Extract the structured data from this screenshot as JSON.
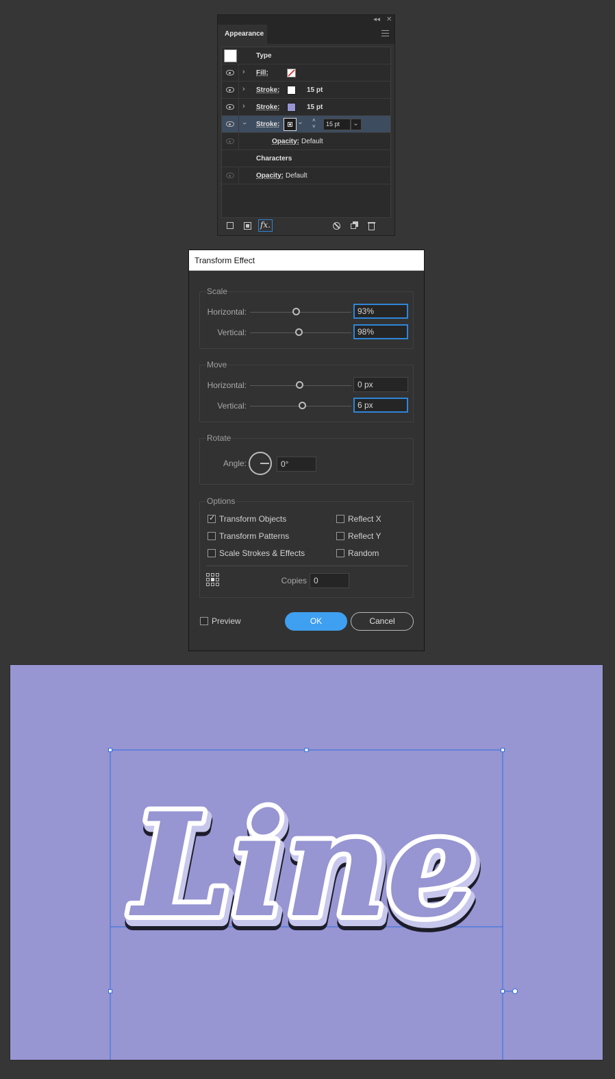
{
  "appearance_panel": {
    "top_controls": {
      "collapse": "◂◂",
      "close": "✕"
    },
    "tab_label": "Appearance",
    "header_label": "Type",
    "rows": [
      {
        "label": "Fill:"
      },
      {
        "label": "Stroke:",
        "value": "15 pt"
      },
      {
        "label": "Stroke:",
        "value": "15 pt"
      },
      {
        "label": "Stroke:",
        "value": "15 pt"
      },
      {
        "label": "Opacity:",
        "value": "Default"
      },
      {
        "label": "Characters"
      },
      {
        "label": "Opacity:",
        "value": "Default"
      }
    ],
    "fx_label": "fx.",
    "colors": {
      "stroke_1": "#ffffff",
      "stroke_2": "#9795d2",
      "selected_row": "#3e4c5f"
    }
  },
  "dialog": {
    "title": "Transform Effect",
    "scale": {
      "title": "Scale",
      "horizontal_label": "Horizontal:",
      "horizontal_value": "93%",
      "vertical_label": "Vertical:",
      "vertical_value": "98%"
    },
    "move": {
      "title": "Move",
      "horizontal_label": "Horizontal:",
      "horizontal_value": "0 px",
      "vertical_label": "Vertical:",
      "vertical_value": "6 px"
    },
    "rotate": {
      "title": "Rotate",
      "angle_label": "Angle:",
      "angle_value": "0°"
    },
    "options": {
      "title": "Options",
      "transform_objects": "Transform Objects",
      "transform_patterns": "Transform Patterns",
      "scale_strokes": "Scale Strokes & Effects",
      "reflect_x": "Reflect X",
      "reflect_y": "Reflect Y",
      "random": "Random",
      "copies_label": "Copies",
      "copies_value": "0"
    },
    "preview_label": "Preview",
    "ok_label": "OK",
    "cancel_label": "Cancel"
  },
  "canvas": {
    "artwork_text": "Line",
    "background_color": "#9795d2",
    "selection_color": "#2f6fe0"
  }
}
